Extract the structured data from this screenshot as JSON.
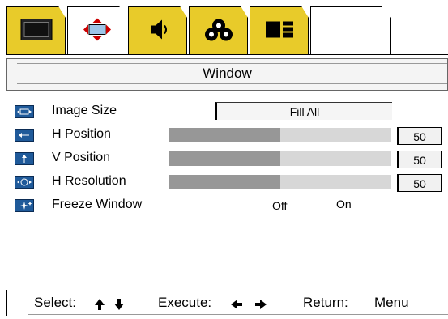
{
  "title": "Window",
  "tabs": [
    {
      "icon": "monitor-icon",
      "active": false
    },
    {
      "icon": "window-icon",
      "active": true
    },
    {
      "icon": "speaker-icon",
      "active": false
    },
    {
      "icon": "color-circles-icon",
      "active": false
    },
    {
      "icon": "layout-blocks-icon",
      "active": false
    }
  ],
  "rows": {
    "image_size": {
      "label": "Image Size",
      "value": "Fill All",
      "icon": "image-size-icon"
    },
    "h_position": {
      "label": "H Position",
      "value": "50",
      "percent": 50,
      "icon": "h-position-icon"
    },
    "v_position": {
      "label": "V Position",
      "value": "50",
      "percent": 50,
      "icon": "v-position-icon"
    },
    "h_resolution": {
      "label": "H Resolution",
      "value": "50",
      "percent": 50,
      "icon": "h-resolution-icon"
    },
    "freeze_window": {
      "label": "Freeze Window",
      "off": "Off",
      "on": "On",
      "icon": "freeze-window-icon"
    }
  },
  "footer": {
    "select_label": "Select:",
    "execute_label": "Execute:",
    "return_label": "Return:",
    "return_key": "Menu"
  }
}
